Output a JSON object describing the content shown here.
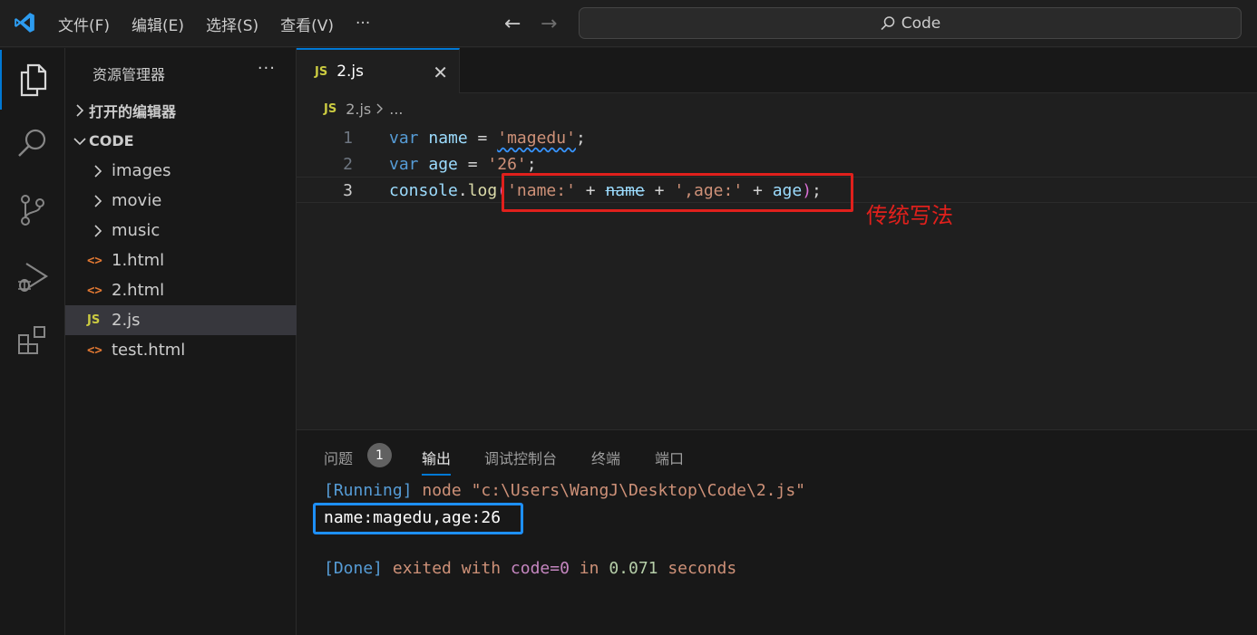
{
  "menu": {
    "items": [
      "文件(F)",
      "编辑(E)",
      "选择(S)",
      "查看(V)"
    ],
    "more": "···"
  },
  "search": {
    "text": "Code"
  },
  "sidebar": {
    "title": "资源管理器",
    "more": "···",
    "open_editors": "打开的编辑器",
    "folder": "CODE",
    "items": [
      {
        "label": "images",
        "kind": "folder"
      },
      {
        "label": "movie",
        "kind": "folder"
      },
      {
        "label": "music",
        "kind": "folder"
      },
      {
        "label": "1.html",
        "kind": "html"
      },
      {
        "label": "2.html",
        "kind": "html"
      },
      {
        "label": "2.js",
        "kind": "js",
        "selected": true
      },
      {
        "label": "test.html",
        "kind": "html"
      }
    ]
  },
  "editor": {
    "tab": {
      "icon_text": "JS",
      "label": "2.js"
    },
    "breadcrumb": {
      "icon_text": "JS",
      "file": "2.js",
      "tail": "..."
    },
    "lines": [
      {
        "num": "1",
        "text": "var name = 'magedu';"
      },
      {
        "num": "2",
        "text": "var age = '26';"
      },
      {
        "num": "3",
        "text": "console.log('name:' + name + ',age:' + age);"
      }
    ],
    "tokens": {
      "var": "var",
      "name": "name",
      "age": "age",
      "eq": " = ",
      "semi": ";",
      "magedu": "'magedu'",
      "age_val": "'26'",
      "console": "console",
      "dot": ".",
      "log": "log",
      "lparen": "(",
      "rparen": ")",
      "s_name": "'name:'",
      "plus": " + ",
      "s_age": "',age:'"
    },
    "annotation": "传统写法"
  },
  "panel": {
    "tabs": [
      "问题",
      "输出",
      "调试控制台",
      "终端",
      "端口"
    ],
    "badge": "1",
    "output": {
      "running_tag": "[Running]",
      "running_cmd": " node \"c:\\Users\\WangJ\\Desktop\\Code\\2.js\"",
      "result": "name:magedu,age:26",
      "done_tag": "[Done]",
      "done_text1": " exited with ",
      "code_text": "code=0",
      "in_text": " in ",
      "time_text": "0.071",
      "seconds_text": " seconds"
    }
  },
  "colors": {
    "accent": "#0078d4",
    "annotation_red": "#e0201c",
    "highlight_blue": "#1e90ff"
  }
}
